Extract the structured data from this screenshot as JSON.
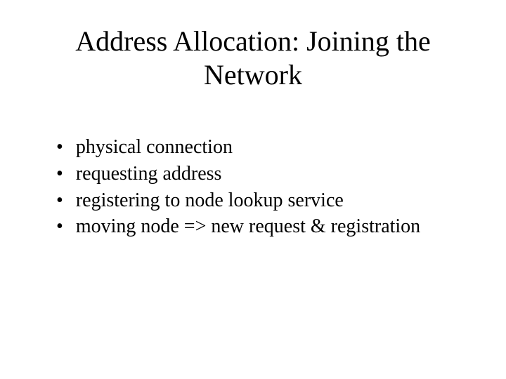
{
  "slide": {
    "title": "Address Allocation: Joining the Network",
    "bullets": [
      "physical connection",
      "requesting address",
      "registering to node lookup service",
      "moving node => new request & registration"
    ]
  }
}
